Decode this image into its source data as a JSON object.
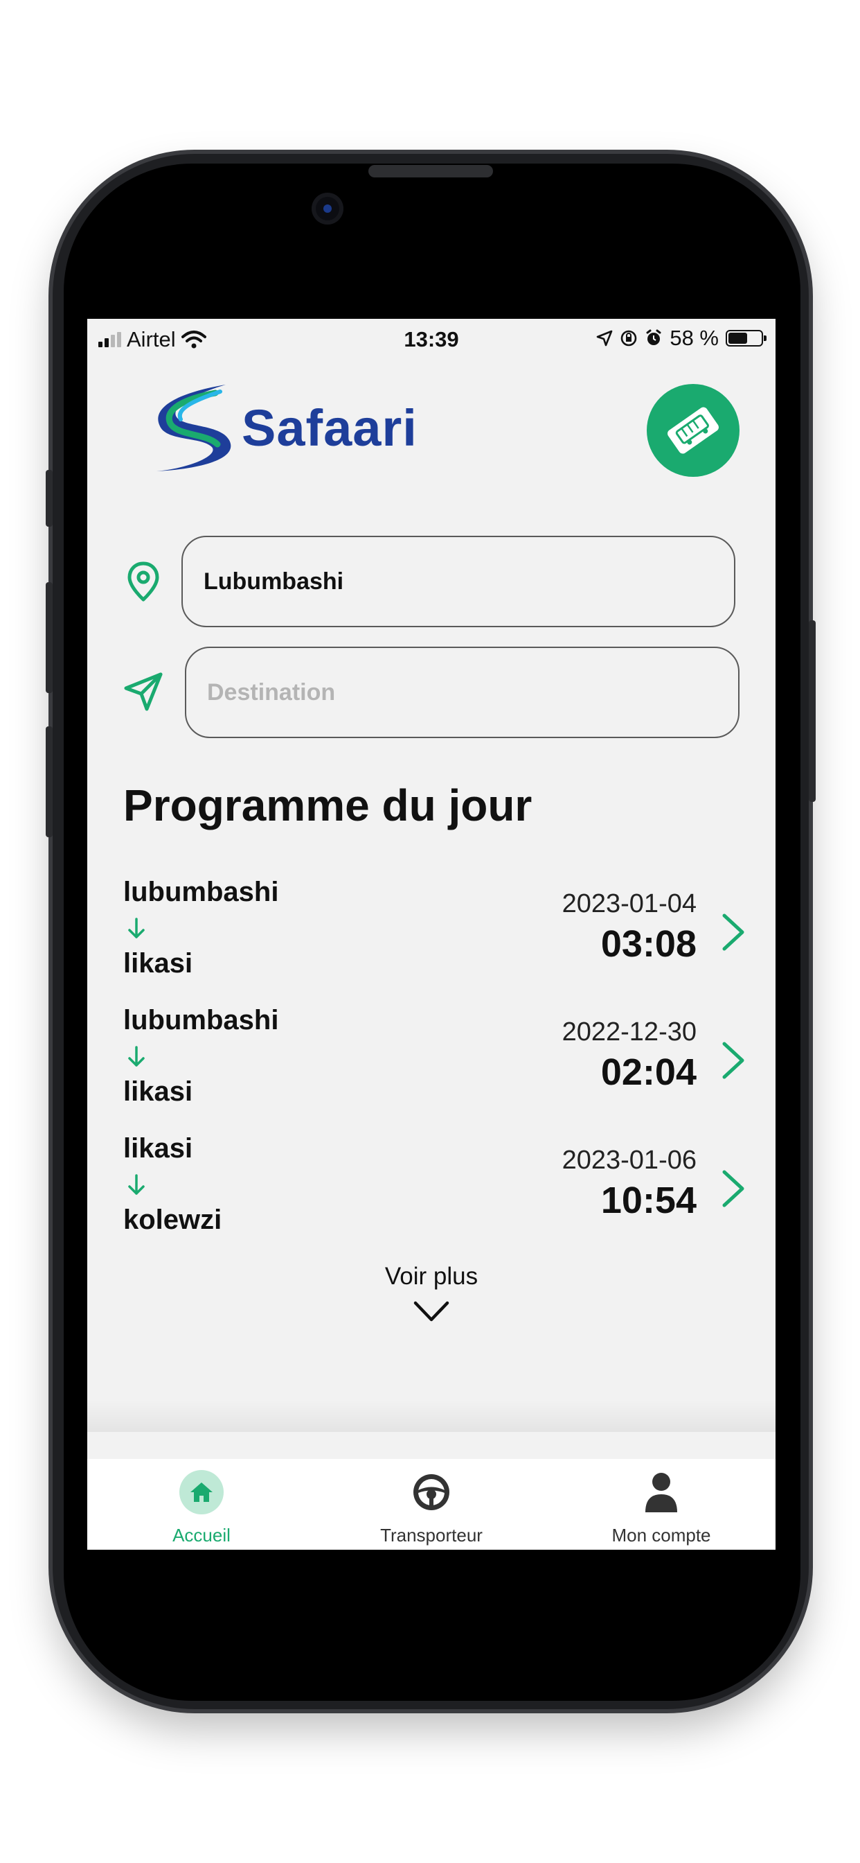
{
  "status_bar": {
    "carrier": "Airtel",
    "time": "13:39",
    "battery": "58 %",
    "battery_level": 0.58
  },
  "header": {
    "logo_text": "Safaari",
    "ticket_button_icon": "bus-ticket-icon"
  },
  "search": {
    "origin_value": "Lubumbashi",
    "destination_placeholder": "Destination",
    "origin_icon": "location-pin-icon",
    "destination_icon": "send-arrow-icon"
  },
  "programme": {
    "title": "Programme du jour",
    "trips": [
      {
        "from": "lubumbashi",
        "to": "likasi",
        "date": "2023-01-04",
        "time": "03:08"
      },
      {
        "from": "lubumbashi",
        "to": "likasi",
        "date": "2022-12-30",
        "time": "02:04"
      },
      {
        "from": "likasi",
        "to": "kolewzi",
        "date": "2023-01-06",
        "time": "10:54"
      }
    ],
    "see_more": "Voir plus"
  },
  "tabbar": {
    "items": [
      {
        "label": "Accueil",
        "icon": "home-icon",
        "active": true
      },
      {
        "label": "Transporteur",
        "icon": "steering-wheel-icon",
        "active": false
      },
      {
        "label": "Mon compte",
        "icon": "user-icon",
        "active": false
      }
    ]
  },
  "colors": {
    "accent": "#1aaa6f",
    "brand_blue": "#1e3e9a",
    "screen_bg": "#f2f2f2"
  }
}
